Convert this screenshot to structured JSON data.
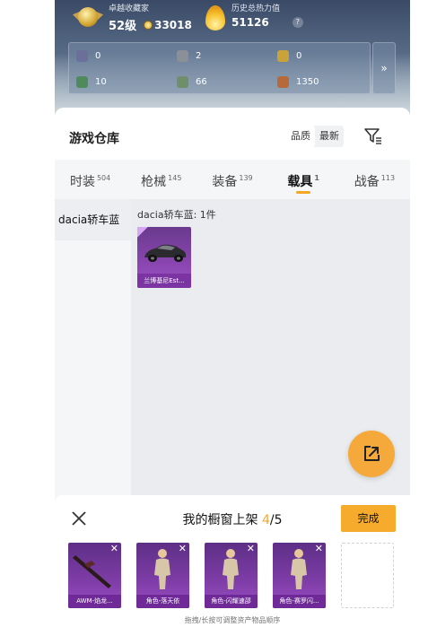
{
  "header": {
    "collector": {
      "caption": "卓越收藏家",
      "level": "52级",
      "coins": "33018"
    },
    "popularity": {
      "caption": "历史总热力值",
      "value": "51126",
      "help": "?"
    },
    "resources": [
      {
        "icon": "card-icon",
        "value": "0",
        "color": "#6b6f9a"
      },
      {
        "icon": "token-icon",
        "value": "2",
        "color": "#8a8f98"
      },
      {
        "icon": "gold-badge-icon",
        "value": "0",
        "color": "#c9a23a"
      },
      {
        "icon": "green-card-icon",
        "value": "10",
        "color": "#4f8a5a"
      },
      {
        "icon": "orb-icon",
        "value": "66",
        "color": "#6f8f6a"
      },
      {
        "icon": "bronze-coin-icon",
        "value": "1350",
        "color": "#b8693a"
      }
    ],
    "more": "»"
  },
  "warehouse": {
    "title": "游戏仓库",
    "sort": [
      "品质",
      "最新"
    ],
    "tabs": [
      {
        "label": "时装",
        "count": "504",
        "active": false
      },
      {
        "label": "枪械",
        "count": "145",
        "active": false
      },
      {
        "label": "装备",
        "count": "139",
        "active": false
      },
      {
        "label": "载具",
        "count": "1",
        "active": true
      },
      {
        "label": "战备",
        "count": "113",
        "active": false
      }
    ],
    "side": [
      "dacia轿车蓝"
    ],
    "group_label": "dacia轿车蓝: 1件",
    "items": [
      {
        "name": "兰博基尼Est..."
      }
    ]
  },
  "showcase": {
    "title_prefix": "我的橱窗上架 ",
    "count": "4",
    "total": "/5",
    "done_label": "完成",
    "close": "✕",
    "slots": [
      {
        "name": "AWM-焰龙...",
        "icon": "awm-rifle-icon"
      },
      {
        "name": "角色-落天依",
        "icon": "character-icon"
      },
      {
        "name": "角色-闪耀速邵",
        "icon": "character-icon"
      },
      {
        "name": "角色-赛罗闪...",
        "icon": "character-icon"
      }
    ],
    "hint": "拖拽/长按可调整资产物品顺序"
  },
  "colors": {
    "accent": "#f6ab2c",
    "purple": "#7f3da8"
  }
}
